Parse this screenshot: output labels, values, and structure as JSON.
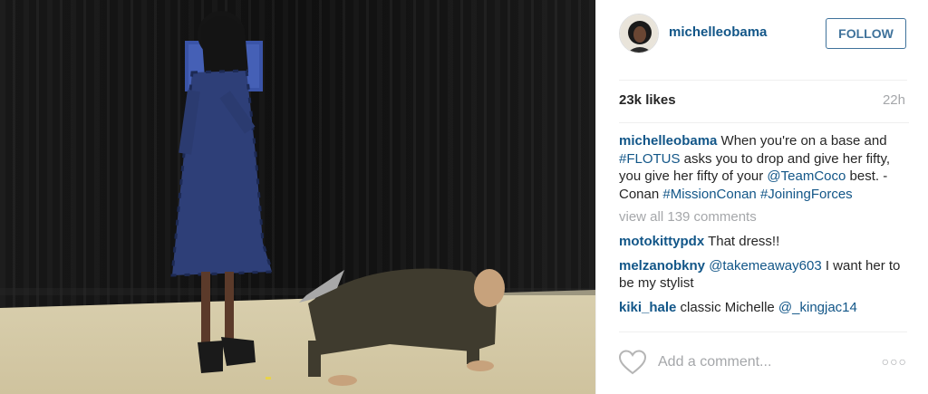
{
  "post": {
    "image_alt": "Photo of a woman in a blue plaid dress laughing while a man does push-ups on the floor in front of a black curtain",
    "colors": {
      "link": "#125688",
      "follow": "#3f729b",
      "muted": "#a5a7aa"
    }
  },
  "header": {
    "username": "michelleobama",
    "follow_label": "FOLLOW"
  },
  "stats": {
    "likes": "23k likes",
    "time": "22h"
  },
  "caption": {
    "username": "michelleobama",
    "text_1": " When you're on a base and ",
    "tag_1": "#FLOTUS",
    "text_2": " asks you to drop and give her fifty, you give her fifty of your ",
    "tag_2": "@TeamCoco",
    "text_3": " best. -Conan ",
    "tag_3": "#MissionConan",
    "text_4": " ",
    "tag_4": "#JoiningForces"
  },
  "view_all": "view all 139 comments",
  "comments": [
    {
      "user": "motokittypdx",
      "mention": "",
      "text": " That dress!!"
    },
    {
      "user": "melzanobkny",
      "mention": "@takemeaway603",
      "text": " I want her to be my stylist"
    },
    {
      "user": "kiki_hale",
      "mention": "@_kingjac14",
      "text": " classic Michelle "
    }
  ],
  "footer": {
    "add_comment_placeholder": "Add a comment...",
    "more_icon": "more-options-icon",
    "like_icon": "heart-icon"
  }
}
